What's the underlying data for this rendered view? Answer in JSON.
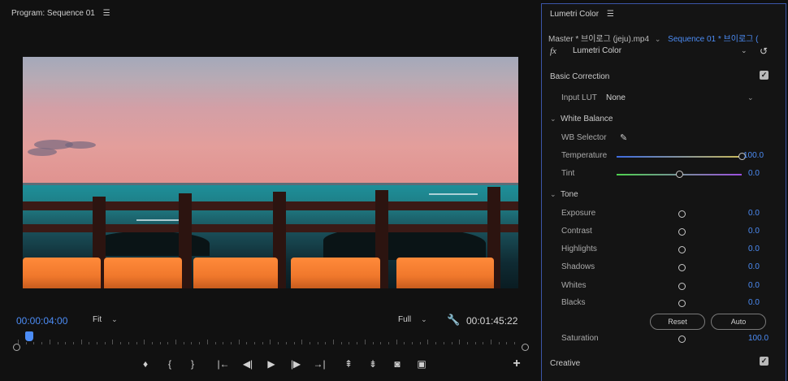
{
  "program": {
    "title": "Program: Sequence 01",
    "menu_icon": "hamburger-icon",
    "timecode_current": "00:00:04:00",
    "fit_label": "Fit",
    "quality_label": "Full",
    "timecode_duration": "00:01:45:22",
    "playhead_progress": 0.03
  },
  "transport": {
    "buttons": [
      {
        "name": "add-marker-button",
        "icon": "marker-icon",
        "glyph": "♦"
      },
      {
        "name": "mark-in-button",
        "icon": "mark-in-icon",
        "glyph": "{"
      },
      {
        "name": "mark-out-button",
        "icon": "mark-out-icon",
        "glyph": "}"
      },
      {
        "name": "go-to-in-button",
        "icon": "go-to-in-icon",
        "glyph": "|←"
      },
      {
        "name": "step-back-button",
        "icon": "step-back-icon",
        "glyph": "◀|"
      },
      {
        "name": "play-button",
        "icon": "play-icon",
        "glyph": "▶"
      },
      {
        "name": "step-forward-button",
        "icon": "step-forward-icon",
        "glyph": "|▶"
      },
      {
        "name": "go-to-out-button",
        "icon": "go-to-out-icon",
        "glyph": "→|"
      },
      {
        "name": "lift-button",
        "icon": "lift-icon",
        "glyph": "⇞"
      },
      {
        "name": "extract-button",
        "icon": "extract-icon",
        "glyph": "⇟"
      },
      {
        "name": "export-frame-button",
        "icon": "camera-icon",
        "glyph": "◙"
      },
      {
        "name": "comparison-view-button",
        "icon": "comparison-icon",
        "glyph": "▣"
      },
      {
        "name": "button-editor-button",
        "icon": "plus-icon",
        "glyph": "+"
      }
    ]
  },
  "lumetri": {
    "title": "Lumetri Color",
    "master_label": "Master * 브이로그 (jeju).mp4",
    "sequence_label": "Sequence 01 * 브이로그 (",
    "fx_label": "fx",
    "effect_name": "Lumetri Color",
    "basic_correction": "Basic Correction",
    "input_lut_label": "Input LUT",
    "input_lut_value": "None",
    "white_balance": "White Balance",
    "wb_selector": "WB Selector",
    "temperature": {
      "label": "Temperature",
      "value": "100.0",
      "level": 1.0
    },
    "tint": {
      "label": "Tint",
      "value": "0.0",
      "level": 0.5
    },
    "tone": "Tone",
    "tone_rows": [
      {
        "label": "Exposure",
        "value": "0.0"
      },
      {
        "label": "Contrast",
        "value": "0.0"
      },
      {
        "label": "Highlights",
        "value": "0.0"
      },
      {
        "label": "Shadows",
        "value": "0.0"
      },
      {
        "label": "Whites",
        "value": "0.0"
      },
      {
        "label": "Blacks",
        "value": "0.0"
      }
    ],
    "reset_label": "Reset",
    "auto_label": "Auto",
    "saturation": {
      "label": "Saturation",
      "value": "100.0"
    },
    "creative": "Creative"
  },
  "colors": {
    "accent": "#4c8cf5",
    "panel_border": "#3b55a8"
  }
}
